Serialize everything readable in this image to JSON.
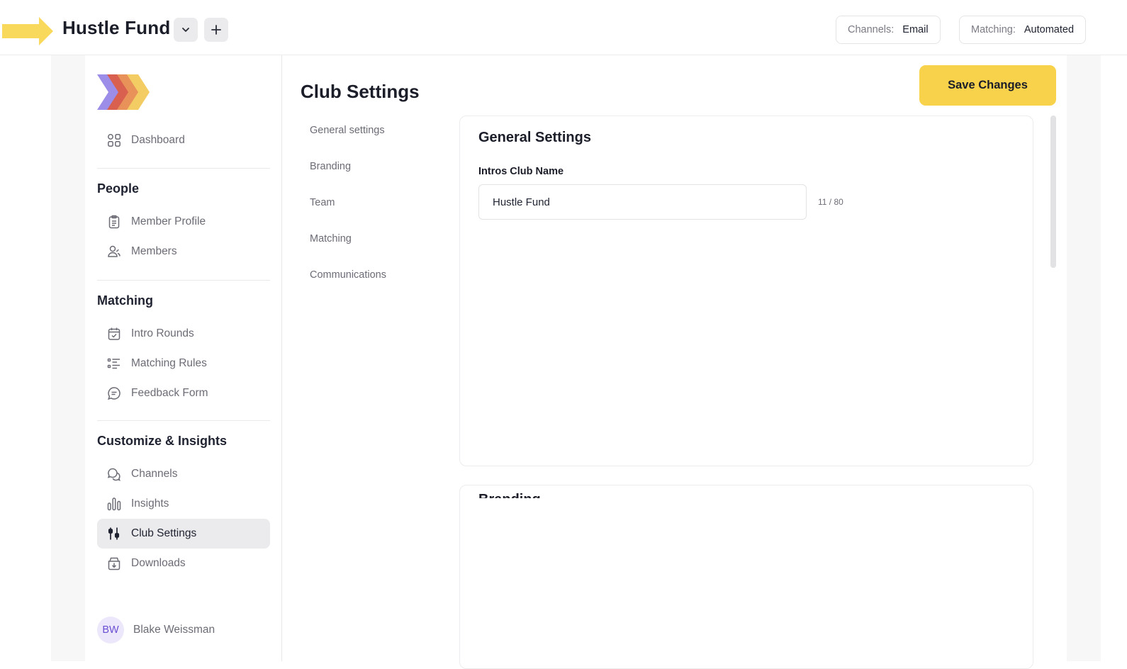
{
  "header": {
    "club_name": "Hustle Fund",
    "channels_label": "Channels:",
    "channels_value": "Email",
    "matching_label": "Matching:",
    "matching_value": "Automated"
  },
  "colors": {
    "accent": "#f7d24a",
    "arrow": "#f8d95c",
    "avatar_bg": "#ece7fb",
    "avatar_fg": "#6b4fd3"
  },
  "sidebar": {
    "dashboard": "Dashboard",
    "sections": {
      "people": "People",
      "matching": "Matching",
      "customize": "Customize & Insights"
    },
    "items": {
      "member_profile": "Member Profile",
      "members": "Members",
      "intro_rounds": "Intro Rounds",
      "matching_rules": "Matching Rules",
      "feedback_form": "Feedback Form",
      "channels": "Channels",
      "insights": "Insights",
      "club_settings": "Club Settings",
      "downloads": "Downloads"
    },
    "user": {
      "initials": "BW",
      "name": "Blake Weissman"
    }
  },
  "main": {
    "title": "Club Settings",
    "save_label": "Save Changes",
    "subnav": [
      "General settings",
      "Branding",
      "Team",
      "Matching",
      "Communications"
    ],
    "general": {
      "title": "General Settings",
      "field_label": "Intros Club Name",
      "field_value": "Hustle Fund",
      "counter": "11 / 80"
    },
    "branding": {
      "title": "Branding"
    }
  }
}
